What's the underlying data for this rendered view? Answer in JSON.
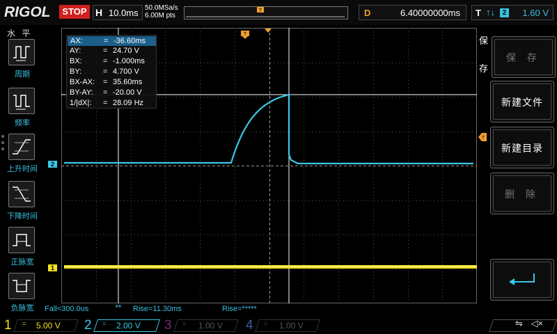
{
  "topbar": {
    "brand": "RIGOL",
    "run_status": "STOP",
    "timebase_label": "H",
    "timebase_value": "10.0ms",
    "sample_rate": "50.0MSa/s",
    "memory_depth": "6.00M pts",
    "trigger_pos_marker": "T",
    "delay_label": "D",
    "delay_value": "6.40000000ms",
    "trigger_label": "T",
    "trigger_source": "2",
    "trigger_level": "1.60 V"
  },
  "left_menu": {
    "title": "水 平",
    "items": [
      {
        "label": "周期",
        "icon": "period-icon"
      },
      {
        "label": "频率",
        "icon": "frequency-icon"
      },
      {
        "label": "上升时间",
        "icon": "rise-time-icon"
      },
      {
        "label": "下降时间",
        "icon": "fall-time-icon"
      },
      {
        "label": "正脉宽",
        "icon": "positive-width-icon"
      },
      {
        "label": "负脉宽",
        "icon": "negative-width-icon"
      }
    ]
  },
  "measurements": [
    {
      "key": "AX:",
      "eq": "=",
      "value": "-36.60ms"
    },
    {
      "key": "AY:",
      "eq": "=",
      "value": "24.70 V"
    },
    {
      "key": "BX:",
      "eq": "=",
      "value": "-1.000ms"
    },
    {
      "key": "BY:",
      "eq": "=",
      "value": "4.700 V"
    },
    {
      "key": "BX-AX:",
      "eq": "=",
      "value": "35.60ms"
    },
    {
      "key": "BY-AY:",
      "eq": "=",
      "value": "-20.00 V"
    },
    {
      "key": "1/|dX|:",
      "eq": "=",
      "value": "28.09 Hz"
    }
  ],
  "markers": {
    "ch2": "2",
    "ch1": "1",
    "trigger_top": "T"
  },
  "readout": {
    "fall": "Fall<300.0us",
    "rise": "Rise=11.30ms",
    "rise2": "Rise=*****"
  },
  "right_menu": {
    "title_chars": [
      "保",
      "存"
    ],
    "buttons": [
      {
        "label": "保 存",
        "enabled": false
      },
      {
        "label": "新建文件",
        "enabled": true
      },
      {
        "label": "新建目录",
        "enabled": true
      },
      {
        "label": "删 除",
        "enabled": false
      },
      {
        "label": "",
        "icon": "return-arrow-icon",
        "enabled": true
      }
    ]
  },
  "channels": [
    {
      "num": "1",
      "coupling": "=",
      "scale": "5.00 V",
      "color": "#f0e020",
      "active": true
    },
    {
      "num": "2",
      "coupling": "=",
      "scale": "2.00 V",
      "color": "#3ac8e8",
      "active": true
    },
    {
      "num": "3",
      "coupling": "=",
      "scale": "1.00 V",
      "color": "#b040b0",
      "active": false
    },
    {
      "num": "4",
      "coupling": "=",
      "scale": "1.00 V",
      "color": "#3060c0",
      "active": false
    }
  ],
  "colors": {
    "ch1": "#f0e020",
    "ch2": "#3ac8e8",
    "trigger": "#f0a030",
    "stop": "#d02020"
  }
}
